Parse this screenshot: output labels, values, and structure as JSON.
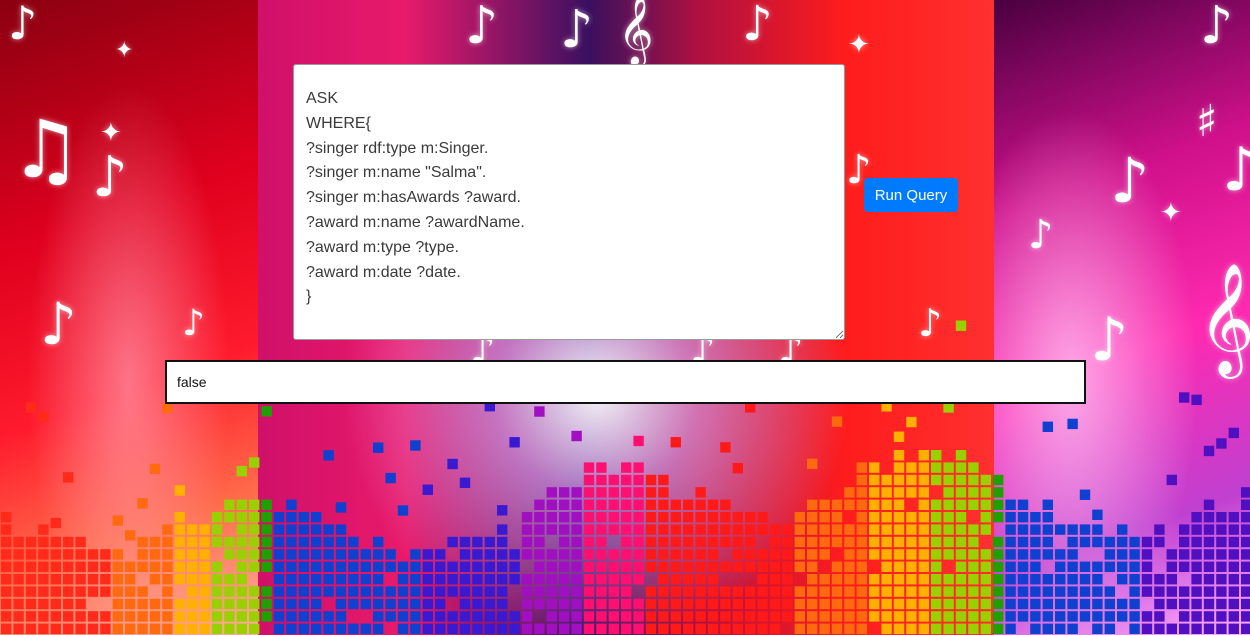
{
  "query_editor": {
    "value": "ASK\nWHERE{\n?singer rdf:type m:Singer.\n?singer m:name \"Salma\".\n?singer m:hasAwards ?award.\n?award m:name ?awardName.\n?award m:type ?type.\n?award m:date ?date.\n}"
  },
  "run_query_button": {
    "label": "Run Query",
    "color": "#007bff"
  },
  "result_field": {
    "value": "false"
  },
  "background": {
    "icons": [
      "music-note-icon",
      "treble-clef-icon",
      "sharp-icon",
      "sparkle-icon"
    ]
  }
}
